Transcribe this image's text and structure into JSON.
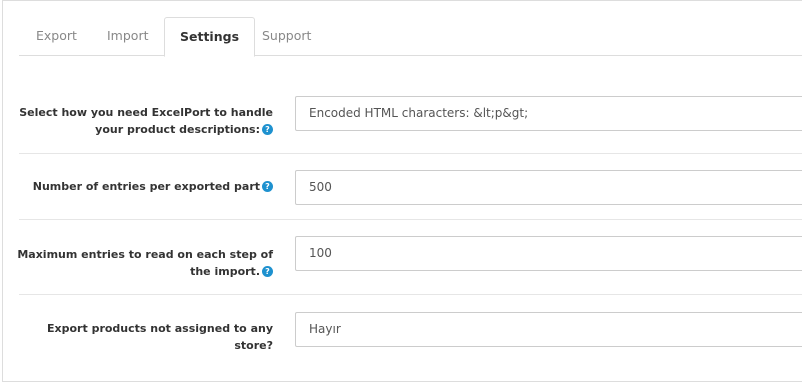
{
  "tabs": [
    {
      "label": "Export"
    },
    {
      "label": "Import"
    },
    {
      "label": "Settings"
    },
    {
      "label": "Support"
    }
  ],
  "active_tab": "Settings",
  "settings": [
    {
      "label": "Select how you need ExcelPort to handle your product descriptions:",
      "value": "Encoded HTML characters: &lt;p&gt;",
      "control": "select",
      "has_help": true
    },
    {
      "label": "Number of entries per exported part",
      "value": "500",
      "control": "input",
      "has_help": true
    },
    {
      "label": "Maximum entries to read on each step of the import.",
      "value": "100",
      "control": "input",
      "has_help": true
    },
    {
      "label": "Export products not assigned to any store?",
      "value": "Hayır",
      "control": "select",
      "has_help": false
    }
  ],
  "help_glyph": "?",
  "accent_color": "#1e91cf"
}
